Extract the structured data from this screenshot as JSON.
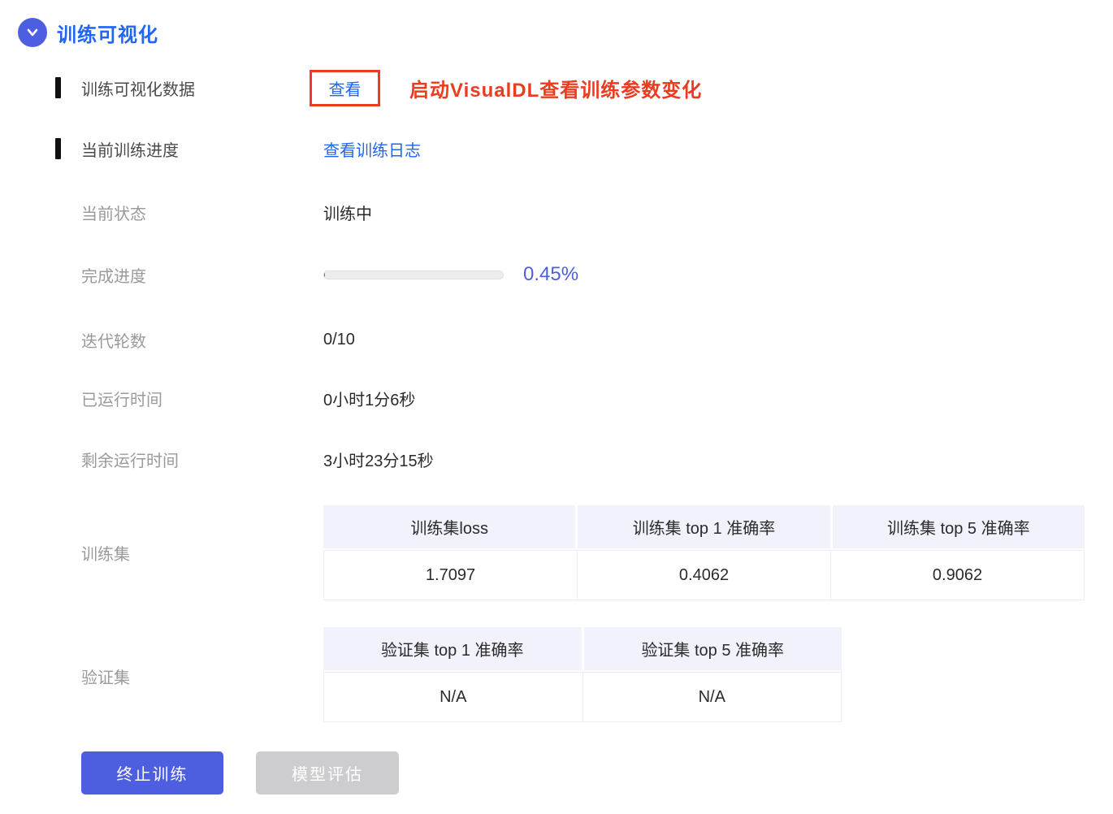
{
  "header": {
    "title": "训练可视化"
  },
  "rows": {
    "visual_data": {
      "label": "训练可视化数据",
      "link": "查看",
      "annotation": "启动VisualDL查看训练参数变化"
    },
    "progress_section": {
      "label": "当前训练进度",
      "link": "查看训练日志"
    },
    "status": {
      "label": "当前状态",
      "value": "训练中"
    },
    "completion": {
      "label": "完成进度",
      "percent_label": "0.45%",
      "percent_value": 0.45
    },
    "epochs": {
      "label": "迭代轮数",
      "value": "0/10"
    },
    "elapsed": {
      "label": "已运行时间",
      "value": "0小时1分6秒"
    },
    "remaining": {
      "label": "剩余运行时间",
      "value": "3小时23分15秒"
    }
  },
  "train_table": {
    "label": "训练集",
    "headers": [
      "训练集loss",
      "训练集 top 1 准确率",
      "训练集 top 5 准确率"
    ],
    "values": [
      "1.7097",
      "0.4062",
      "0.9062"
    ]
  },
  "val_table": {
    "label": "验证集",
    "headers": [
      "验证集 top 1 准确率",
      "验证集 top 5 准确率"
    ],
    "values": [
      "N/A",
      "N/A"
    ]
  },
  "buttons": {
    "stop": "终止训练",
    "evaluate": "模型评估"
  },
  "colors": {
    "link_blue": "#2166F2",
    "accent_violet": "#4D5EE0",
    "alert_red": "#EB3C1F",
    "disabled_gray": "#CDCDCF",
    "table_header_bg": "#F1F2FB"
  }
}
